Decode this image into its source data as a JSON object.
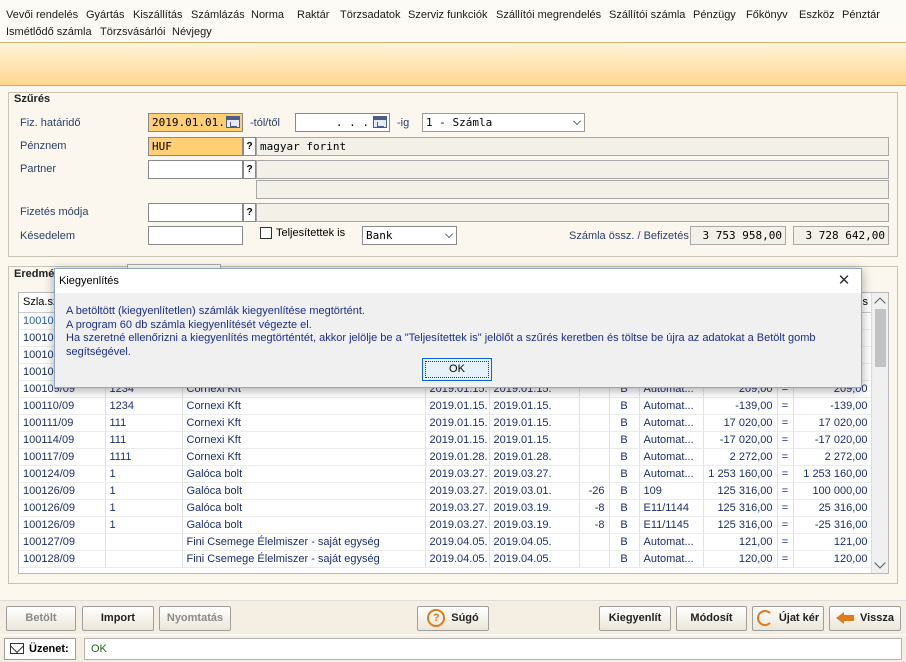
{
  "menu": {
    "row1": [
      "Vevői rendelés",
      "Gyártás",
      "Kiszállítás",
      "Számlázás",
      "Norma",
      "Raktár",
      "Törzsadatok",
      "Szerviz funkciók",
      "Szállítói megrendelés",
      "Szállítói számla",
      "Pénzügy",
      "Főkönyv",
      "Eszköz",
      "Pénztár"
    ],
    "row2": [
      "Ismétlődő számla",
      "Törzsvásárlói",
      "Névjegy"
    ]
  },
  "filter": {
    "title": "Szűrés",
    "due_label": "Fiz. határidő",
    "due_from": "2019.01.01.",
    "from_suffix": "-tól/től",
    "due_to": " .  .  . ",
    "to_suffix": "-ig",
    "doc_type": "1 - Számla",
    "currency_label": "Pénznem",
    "currency_code": "HUF",
    "currency_name": "magyar forint",
    "partner_label": "Partner",
    "partner_code": "",
    "partner_name": "",
    "partner_extra": "",
    "payment_label": "Fizetés módja",
    "payment_code": "",
    "payment_name": "",
    "delay_label": "Késedelem",
    "delay_value": "",
    "completed_label": "Teljesítettek is",
    "bank_value": "Bank",
    "totals_label": "Számla össz. / Befizetés",
    "total_invoice": "3 753 958,00",
    "total_paid": "3 728 642,00",
    "question_mark": "?"
  },
  "results": {
    "title": "Eredmé",
    "col_first": "Szla.sz",
    "col_last": "s",
    "rows": [
      [
        "10010",
        "",
        "",
        "",
        "",
        "",
        "",
        "",
        "",
        "",
        ""
      ],
      [
        "10010",
        "",
        "",
        "",
        "",
        "",
        "",
        "",
        "",
        "",
        ""
      ],
      [
        "10010",
        "",
        "",
        "",
        "",
        "",
        "",
        "",
        "",
        "",
        ""
      ],
      [
        "10010",
        "",
        "",
        "",
        "",
        "",
        "",
        "",
        "",
        "",
        ""
      ],
      [
        "100109/09",
        "1234",
        "Cornexi Kft",
        "2019.01.15.",
        "2019.01.15.",
        "",
        "B",
        "Automat...",
        "209,00",
        "=",
        "209,00"
      ],
      [
        "100110/09",
        "1234",
        "Cornexi Kft",
        "2019.01.15.",
        "2019.01.15.",
        "",
        "B",
        "Automat...",
        "-139,00",
        "=",
        "-139,00"
      ],
      [
        "100111/09",
        "111",
        "Cornexi Kft",
        "2019.01.15.",
        "2019.01.15.",
        "",
        "B",
        "Automat...",
        "17 020,00",
        "=",
        "17 020,00"
      ],
      [
        "100114/09",
        "111",
        "Cornexi Kft",
        "2019.01.15.",
        "2019.01.15.",
        "",
        "B",
        "Automat...",
        "-17 020,00",
        "=",
        "-17 020,00"
      ],
      [
        "100117/09",
        "1111",
        "Cornexi Kft",
        "2019.01.28.",
        "2019.01.28.",
        "",
        "B",
        "Automat...",
        "2 272,00",
        "=",
        "2 272,00"
      ],
      [
        "100124/09",
        "1",
        "Galóca bolt",
        "2019.03.27.",
        "2019.03.27.",
        "",
        "B",
        "Automat...",
        "1 253 160,00",
        "=",
        "1 253 160,00"
      ],
      [
        "100126/09",
        "1",
        "Galóca bolt",
        "2019.03.27.",
        "2019.03.01.",
        "-26",
        "B",
        "109",
        "125 316,00",
        "=",
        "100 000,00"
      ],
      [
        "100126/09",
        "1",
        "Galóca bolt",
        "2019.03.27.",
        "2019.03.19.",
        "-8",
        "B",
        "E11/1144",
        "125 316,00",
        "=",
        "25 316,00"
      ],
      [
        "100126/09",
        "1",
        "Galóca bolt",
        "2019.03.27.",
        "2019.03.19.",
        "-8",
        "B",
        "E11/1145",
        "125 316,00",
        "=",
        "-25 316,00"
      ],
      [
        "100127/09",
        "",
        "Fini Csemege Élelmiszer - saját egység",
        "2019.04.05.",
        "2019.04.05.",
        "",
        "B",
        "Automat...",
        "121,00",
        "=",
        "121,00"
      ],
      [
        "100128/09",
        "",
        "Fini Csemege Élelmiszer - saját egység",
        "2019.04.05.",
        "2019.04.05.",
        "",
        "B",
        "Automat...",
        "120,00",
        "=",
        "120,00"
      ]
    ]
  },
  "buttons": {
    "loaded": "Betölt",
    "import": "Import",
    "print": "Nyomtatás",
    "help": "Súgó",
    "settle": "Kiegyenlít",
    "modify": "Módosít",
    "refresh": "Újat kér",
    "back": "Vissza",
    "help_glyph": "?"
  },
  "status": {
    "label": "Üzenet:",
    "value": "OK"
  },
  "dialog": {
    "title": "Kiegyenlítés",
    "close": "✕",
    "line1": "A betöltött (kiegyenlítetlen) számlák kiegyenlítése megtörtént.",
    "line2": "A program 60 db számla kiegyenlítését végezte el.",
    "line3": "Ha szeretné ellenőrizni a kiegyenlítés megtörténtét, akkor jelölje be a \"Teljesítettek is\" jelölőt a szűrés keretben és töltse be újra az adatokat a Betölt gomb segítségével.",
    "ok": "OK"
  },
  "colors": {
    "highlight": "#ffcf73",
    "accent": "#e07a1a",
    "banner_end": "#ffd690"
  }
}
